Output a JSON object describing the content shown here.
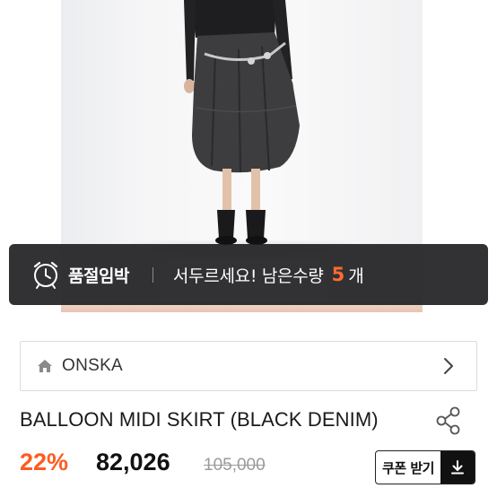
{
  "product_image": {
    "alt_icon": "model-photo-skirt"
  },
  "banner": {
    "icon": "alarm-clock-icon",
    "label": "품절임박",
    "message": "서두르세요! 남은수량",
    "count": "5",
    "unit": "개",
    "accent_color": "#ff6a33"
  },
  "brand": {
    "icon": "home-icon",
    "name": "ONSKA",
    "chevron_icon": "chevron-right-icon"
  },
  "product": {
    "title": "BALLOON MIDI SKIRT (BLACK DENIM)",
    "share_icon": "share-icon"
  },
  "price": {
    "discount": "22%",
    "sale": "82,026",
    "original": "105,000",
    "discount_color": "#ff5a1f"
  },
  "coupon": {
    "label": "쿠폰 받기",
    "icon": "download-icon"
  }
}
